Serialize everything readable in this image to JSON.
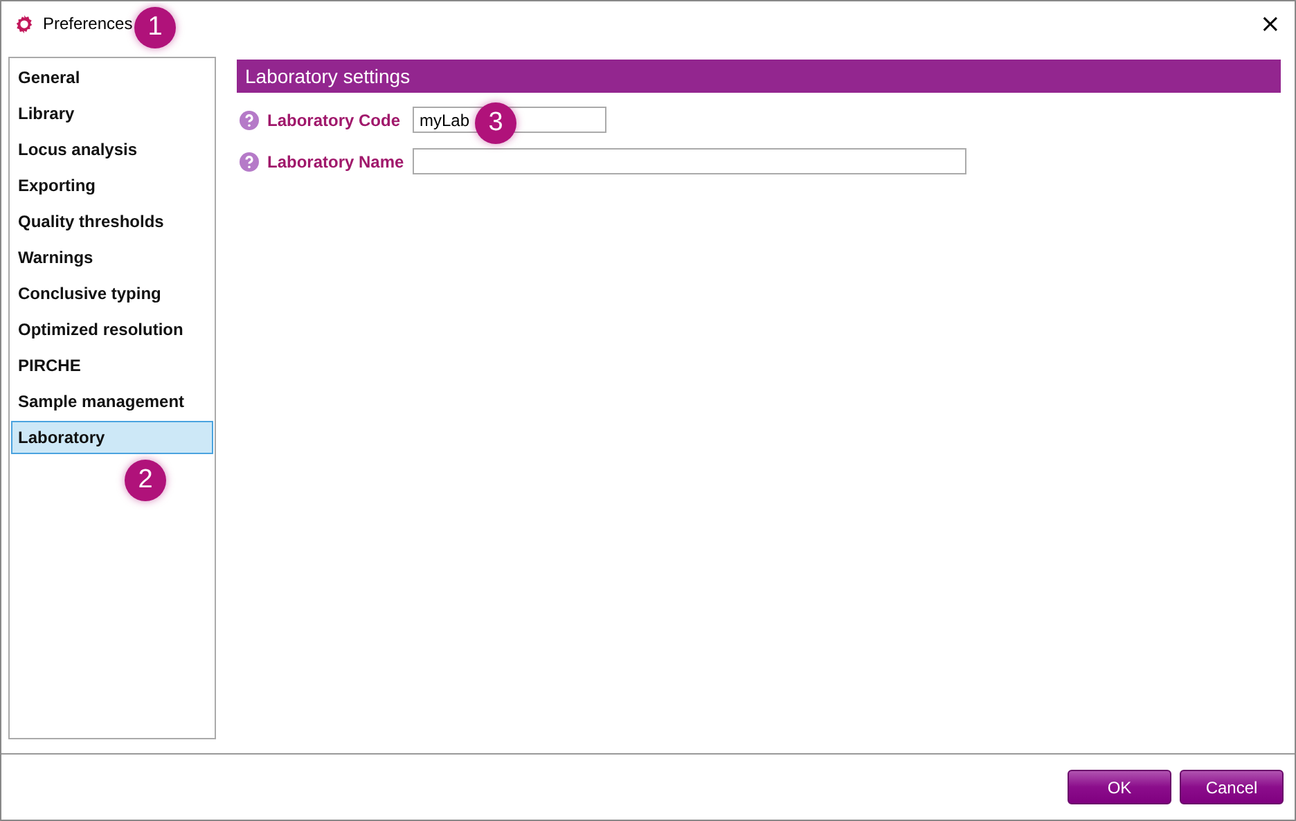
{
  "window": {
    "title": "Preferences",
    "close": "×"
  },
  "sidebar": {
    "items": [
      {
        "label": "General",
        "selected": false
      },
      {
        "label": "Library",
        "selected": false
      },
      {
        "label": "Locus analysis",
        "selected": false
      },
      {
        "label": "Exporting",
        "selected": false
      },
      {
        "label": "Quality thresholds",
        "selected": false
      },
      {
        "label": "Warnings",
        "selected": false
      },
      {
        "label": "Conclusive typing",
        "selected": false
      },
      {
        "label": "Optimized resolution",
        "selected": false
      },
      {
        "label": "PIRCHE",
        "selected": false
      },
      {
        "label": "Sample management",
        "selected": false
      },
      {
        "label": "Laboratory",
        "selected": true
      }
    ]
  },
  "section": {
    "title": "Laboratory settings",
    "fields": [
      {
        "label": "Laboratory Code",
        "value": "myLab"
      },
      {
        "label": "Laboratory Name"
      }
    ]
  },
  "buttons": [
    "OK",
    "Cancel"
  ],
  "callouts": [
    "1",
    "2",
    "3"
  ]
}
